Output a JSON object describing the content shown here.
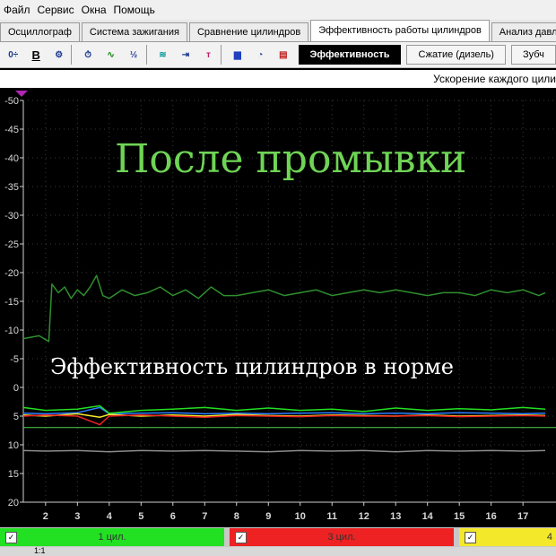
{
  "menu": [
    "Файл",
    "Сервис",
    "Окна",
    "Помощь"
  ],
  "tabs": [
    {
      "label": "Осциллограф",
      "active": false
    },
    {
      "label": "Система зажигания",
      "active": false
    },
    {
      "label": "Сравнение цилиндров",
      "active": false
    },
    {
      "label": "Эффективность работы цилиндров",
      "active": true
    },
    {
      "label": "Анализ давле",
      "active": false
    }
  ],
  "toolbar": {
    "icons": [
      "spin-icon",
      "bold-icon",
      "rpm-icon",
      "time-icon",
      "wave-icon",
      "algorithm-icon",
      "sync-icon",
      "range-icon",
      "marker-icon",
      "bars-icon",
      "counter-icon",
      "tag-icon"
    ],
    "subtabs": [
      {
        "label": "Эффективность",
        "active": true
      },
      {
        "label": "Сжатие (дизель)",
        "active": false
      },
      {
        "label": "Зубч",
        "active": false
      }
    ]
  },
  "chart_title": "Ускорение каждого цили",
  "overlay": {
    "headline": "После промывки",
    "caption": "Эффективность цилиндров в норме"
  },
  "legend": [
    {
      "label": "1 цил.",
      "color": "#22e022",
      "checked": true
    },
    {
      "label": "3 цил.",
      "color": "#ee2222",
      "checked": true
    },
    {
      "label": "4",
      "color": "#f3e82a",
      "checked": true
    }
  ],
  "status": {
    "zoom": "1:1"
  },
  "chart_data": {
    "type": "line",
    "y_ticks": [
      -50,
      -45,
      -40,
      -35,
      -30,
      -25,
      -20,
      -15,
      -10,
      -5,
      0,
      5,
      10,
      15,
      20
    ],
    "ylim": [
      -50,
      20
    ],
    "x_ticks": [
      2,
      3,
      4,
      5,
      6,
      7,
      8,
      9,
      10,
      11,
      12,
      13,
      14,
      15,
      16,
      17
    ],
    "xlim": [
      1.3,
      17.7
    ],
    "grid": true,
    "series": [
      {
        "name": "",
        "color": "#2e8f2e",
        "x": [
          1.3,
          1.8,
          2.1,
          2.2,
          2.4,
          2.6,
          2.8,
          3.0,
          3.2,
          3.4,
          3.6,
          3.8,
          4.0,
          4.4,
          4.8,
          5.2,
          5.6,
          6.0,
          6.4,
          6.8,
          7.2,
          7.6,
          8.0,
          8.5,
          9.0,
          9.5,
          10.0,
          10.5,
          11.0,
          11.5,
          12.0,
          12.5,
          13.0,
          13.5,
          14.0,
          14.5,
          15.0,
          15.5,
          16.0,
          16.5,
          17.0,
          17.5,
          17.7
        ],
        "y": [
          -8.5,
          -9,
          -8,
          -18,
          -16.5,
          -17.5,
          -15.5,
          -17,
          -16,
          -17.5,
          -19.5,
          -16,
          -15.5,
          -17,
          -16,
          -16.5,
          -17.5,
          -16,
          -17,
          -15.5,
          -17.5,
          -16,
          -16,
          -16.5,
          -17,
          -16,
          -16.5,
          -17,
          -16,
          -16.5,
          -17,
          -16.5,
          -17,
          -16.5,
          -16,
          -16.5,
          -16.5,
          -16,
          -17,
          -16.5,
          -17,
          -16,
          -16.5
        ]
      },
      {
        "name": "1 цил.",
        "color": "#22e022",
        "x": [
          1.3,
          2,
          3,
          3.7,
          4,
          5,
          6,
          7,
          8,
          9,
          10,
          11,
          12,
          13,
          14,
          15,
          16,
          17,
          17.7
        ],
        "y": [
          3.5,
          4,
          3.8,
          3.2,
          4.5,
          4,
          3.8,
          3.5,
          4,
          3.6,
          4,
          3.8,
          4.2,
          3.6,
          4,
          3.7,
          3.9,
          3.5,
          3.8
        ]
      },
      {
        "name": "3 цил.",
        "color": "#ee2222",
        "x": [
          1.3,
          2,
          3,
          3.7,
          4,
          5,
          6,
          7,
          8,
          9,
          10,
          11,
          12,
          13,
          14,
          15,
          16,
          17,
          17.7
        ],
        "y": [
          5,
          4.8,
          5,
          6.5,
          5,
          4.8,
          5,
          5.2,
          4.9,
          5,
          5.1,
          4.9,
          5,
          5,
          4.9,
          5.1,
          5,
          4.9,
          5
        ]
      },
      {
        "name": "4",
        "color": "#f3e82a",
        "x": [
          1.3,
          2,
          3,
          3.7,
          4,
          5,
          6,
          7,
          8,
          9,
          10,
          11,
          12,
          13,
          14,
          15,
          16,
          17,
          17.7
        ],
        "y": [
          4.8,
          5,
          4.6,
          5.2,
          4.7,
          5,
          4.8,
          5,
          4.7,
          4.9,
          5,
          4.8,
          4.9,
          5,
          4.8,
          5,
          4.9,
          4.8,
          4.9
        ]
      },
      {
        "name": "",
        "color": "#2a7fff",
        "x": [
          1.3,
          2,
          3,
          3.7,
          4,
          5,
          6,
          7,
          8,
          9,
          10,
          11,
          12,
          13,
          14,
          15,
          16,
          17,
          17.7
        ],
        "y": [
          4.5,
          4.6,
          4.4,
          3.5,
          4.6,
          4.5,
          4.4,
          4.6,
          4.5,
          4.6,
          4.5,
          4.4,
          4.6,
          4.5,
          4.6,
          4.4,
          4.5,
          4.6,
          4.5
        ]
      },
      {
        "name": "",
        "color": "#8a8a8a",
        "x": [
          1.3,
          2,
          3,
          4,
          5,
          6,
          7,
          8,
          9,
          10,
          11,
          12,
          13,
          14,
          15,
          16,
          17,
          17.7
        ],
        "y": [
          11,
          11.1,
          11,
          11.2,
          11,
          11.1,
          11,
          11.1,
          11.2,
          11,
          11.1,
          11,
          11.2,
          11,
          11.1,
          11,
          11.1,
          11
        ]
      }
    ],
    "hline": 7
  }
}
